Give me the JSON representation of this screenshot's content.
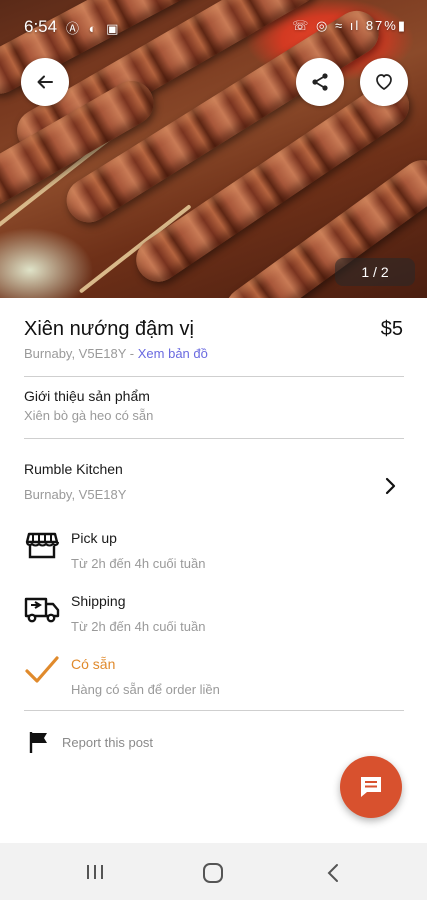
{
  "status_bar": {
    "time": "6:54",
    "left_icons": "Ⓐ ◐ ▣",
    "right_status": "☏ ◎ ≈ ıl 87%▮"
  },
  "hero": {
    "pager_text": "1 / 2"
  },
  "product": {
    "title": "Xiên nướng đậm vị",
    "price": "$5",
    "location": "Burnaby, V5E18Y",
    "separator": "-",
    "map_link": "Xem bản đồ"
  },
  "description": {
    "heading": "Giới thiệu sản phẩm",
    "text": "Xiên bò gà heo có sẵn"
  },
  "shop": {
    "name": "Rumble Kitchen",
    "location": "Burnaby, V5E18Y"
  },
  "features": [
    {
      "title": "Pick up",
      "subtitle": "Từ 2h đến 4h cuối tuần",
      "icon": "store-icon"
    },
    {
      "title": "Shipping",
      "subtitle": "Từ 2h đến 4h cuối tuần",
      "icon": "delivery-truck-icon"
    },
    {
      "title": "Có sẵn",
      "subtitle": "Hàng có sẵn để order liền",
      "icon": "checkmark-icon"
    }
  ],
  "report": {
    "label": "Report this post"
  },
  "colors": {
    "accent_orange": "#e08a2c",
    "fab": "#d8512e",
    "link": "#6a6ae0"
  }
}
